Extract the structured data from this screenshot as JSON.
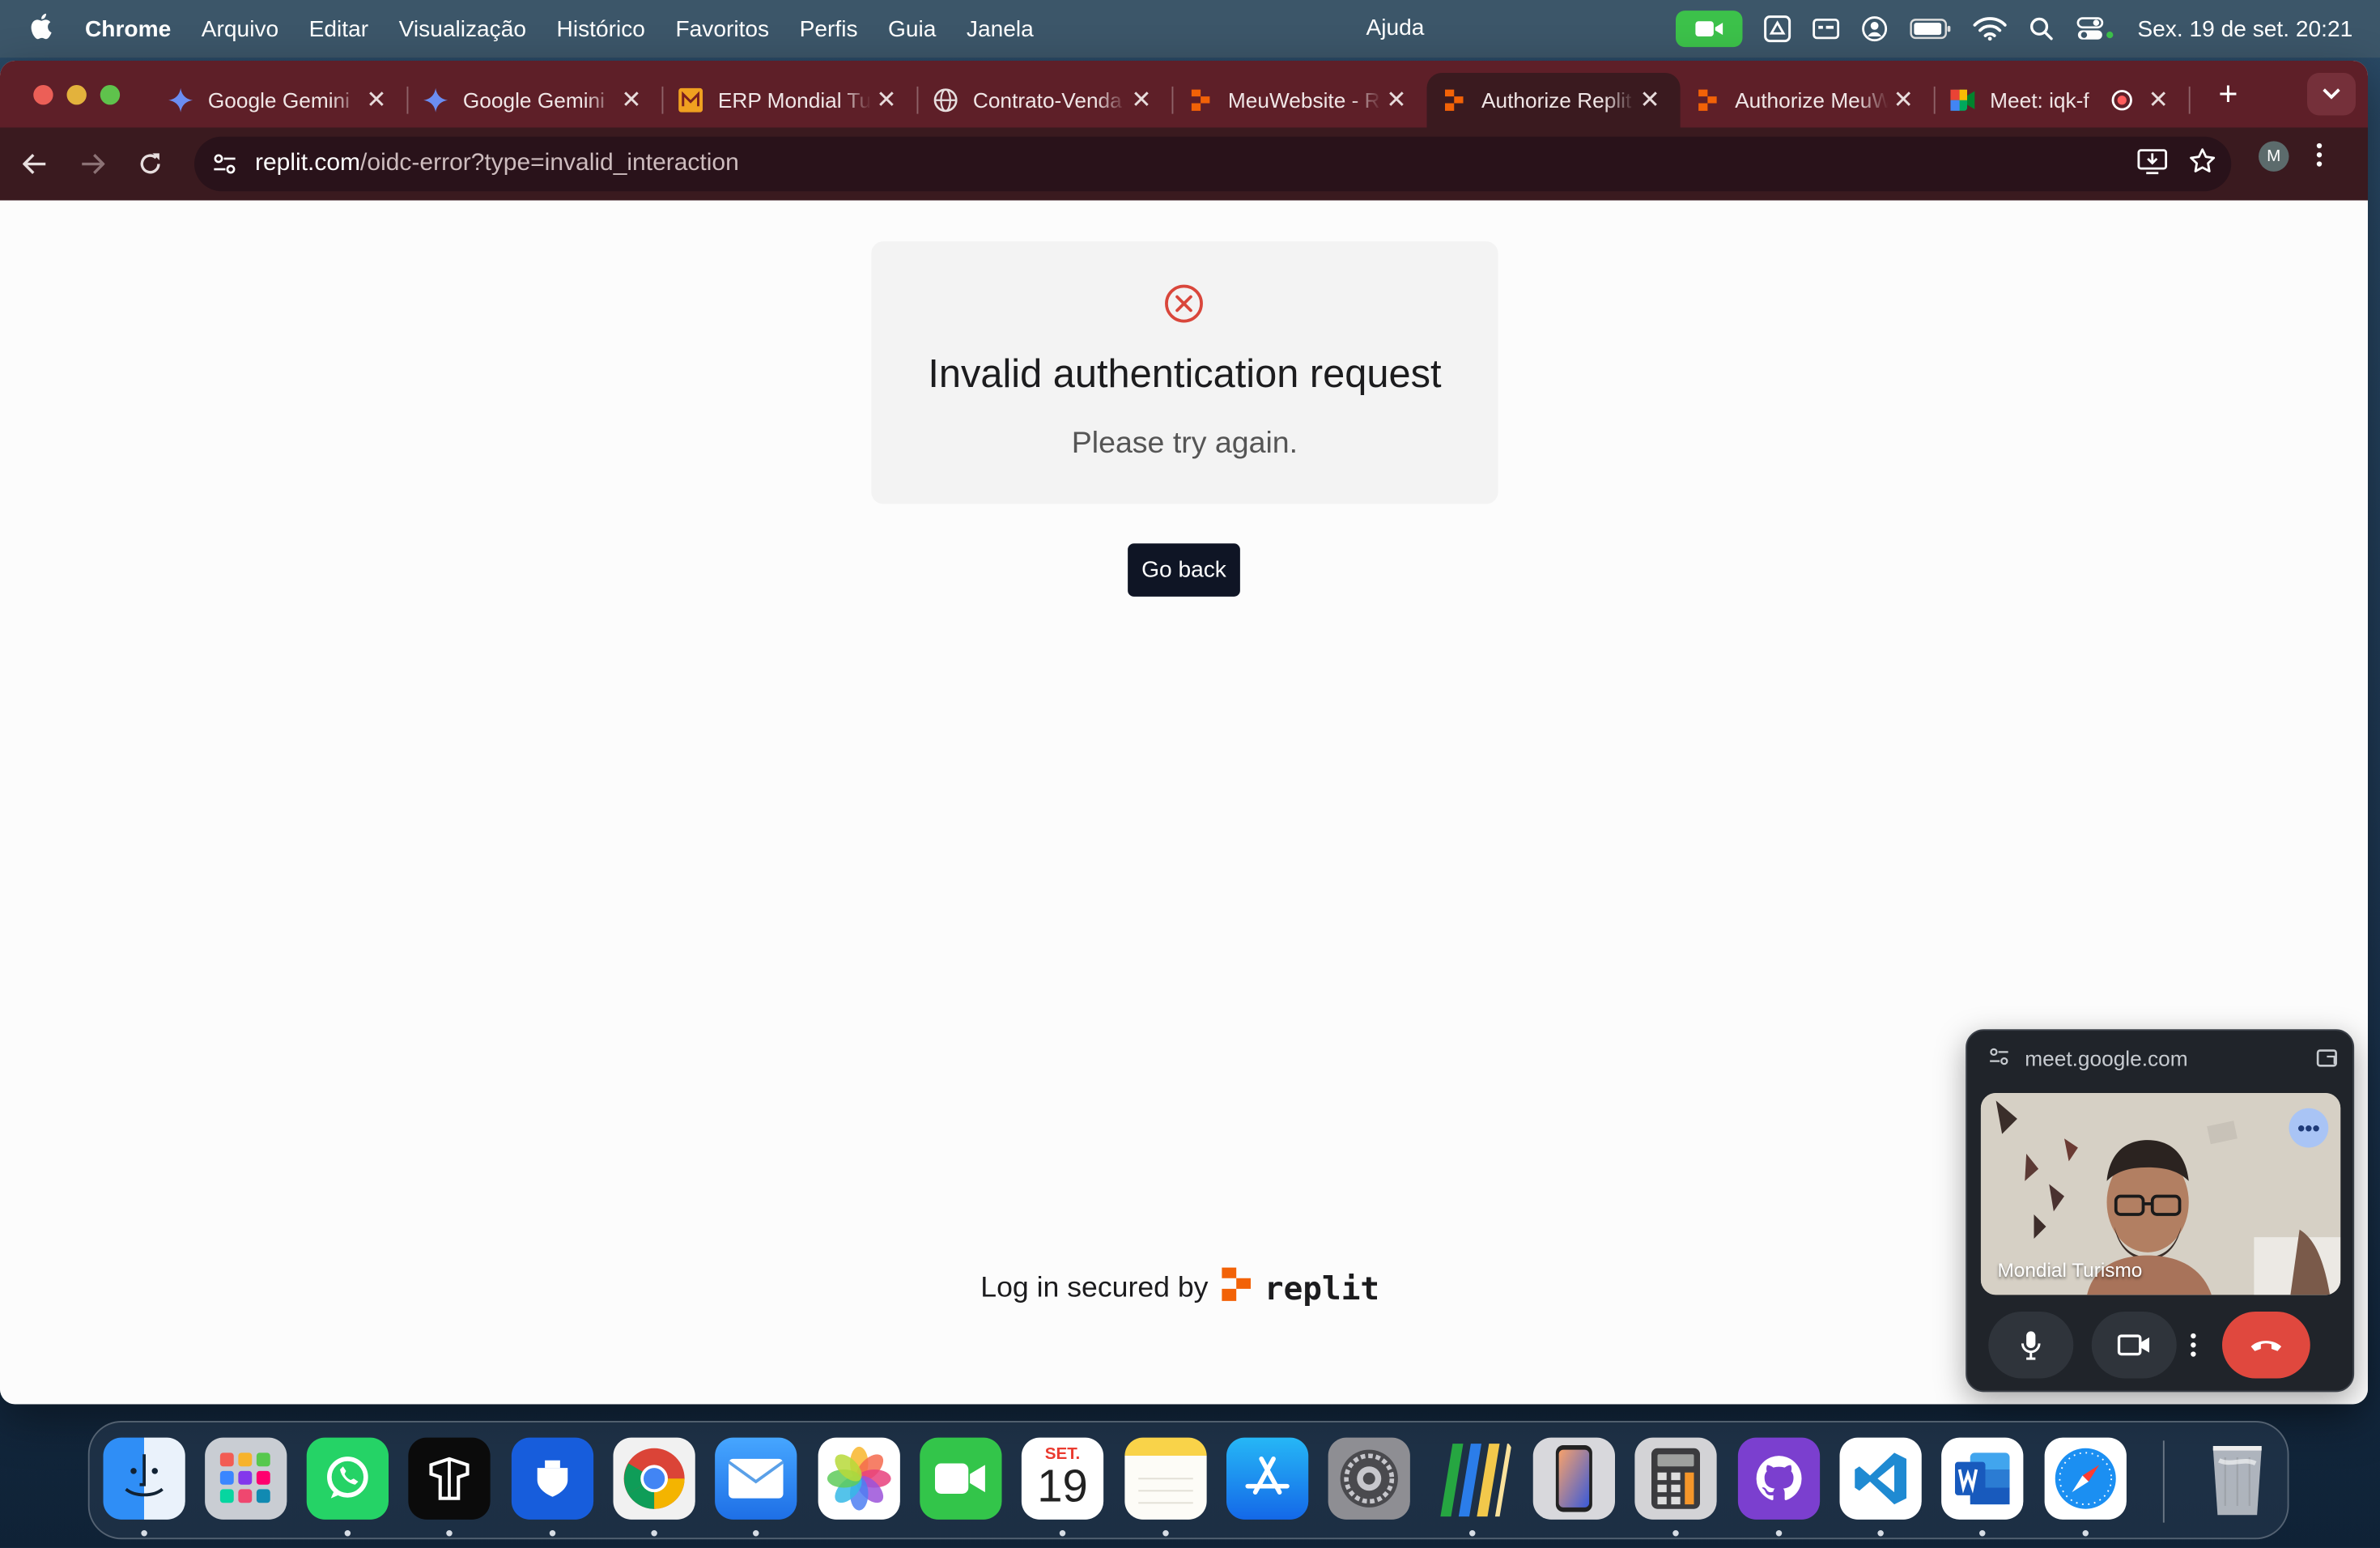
{
  "menubar": {
    "app_name": "Chrome",
    "menus": [
      "Arquivo",
      "Editar",
      "Visualização",
      "Histórico",
      "Favoritos",
      "Perfis",
      "Guia",
      "Janela"
    ],
    "help": "Ajuda",
    "clock": "Sex. 19 de set.  20:21"
  },
  "tabs": [
    {
      "label": "Google Gemini",
      "icon": "gemini-icon"
    },
    {
      "label": "Google Gemini",
      "icon": "gemini-icon"
    },
    {
      "label": "ERP Mondial Turismo",
      "icon": "erp-icon"
    },
    {
      "label": "Contrato-Venda",
      "icon": "globe-icon"
    },
    {
      "label": "MeuWebsite - Replit",
      "icon": "replit-icon"
    },
    {
      "label": "Authorize Replit",
      "icon": "replit-icon"
    },
    {
      "label": "Authorize MeuWebsite",
      "icon": "replit-icon"
    },
    {
      "label": "Meet: iqk-f",
      "icon": "meet-icon"
    }
  ],
  "active_tab_index": 5,
  "address_bar": {
    "host": "replit.com",
    "path": "/oidc-error?type=invalid_interaction"
  },
  "profile_initial": "M",
  "page": {
    "error_title": "Invalid authentication request",
    "error_subtitle": "Please try again.",
    "go_back_label": "Go back",
    "footer_text": "Log in secured by",
    "brand_wordmark": "replit"
  },
  "meet_pip": {
    "url": "meet.google.com",
    "participant_name": "Mondial Turismo"
  },
  "colors": {
    "tab_strip": "#5e1f28",
    "toolbar": "#3a1a1f",
    "error_red": "#d9463b",
    "button_dark": "#0f1525",
    "replit_orange": "#f26207",
    "hangup_red": "#e0483e"
  },
  "dock": {
    "calendar_month": "SET.",
    "calendar_day": "19",
    "apps": [
      "finder-icon",
      "launchpad-icon",
      "whatsapp-icon",
      "terminal-icon",
      "bitwarden-icon",
      "chrome-icon",
      "mail-icon",
      "photos-icon",
      "facetime-icon",
      "calendar-icon",
      "notes-icon",
      "app-store-icon",
      "system-settings-icon",
      "numbers-icon",
      "iphone-mirroring-icon",
      "calculator-icon",
      "github-desktop-icon",
      "vscode-icon",
      "word-icon",
      "safari-icon",
      "trash-icon"
    ]
  }
}
